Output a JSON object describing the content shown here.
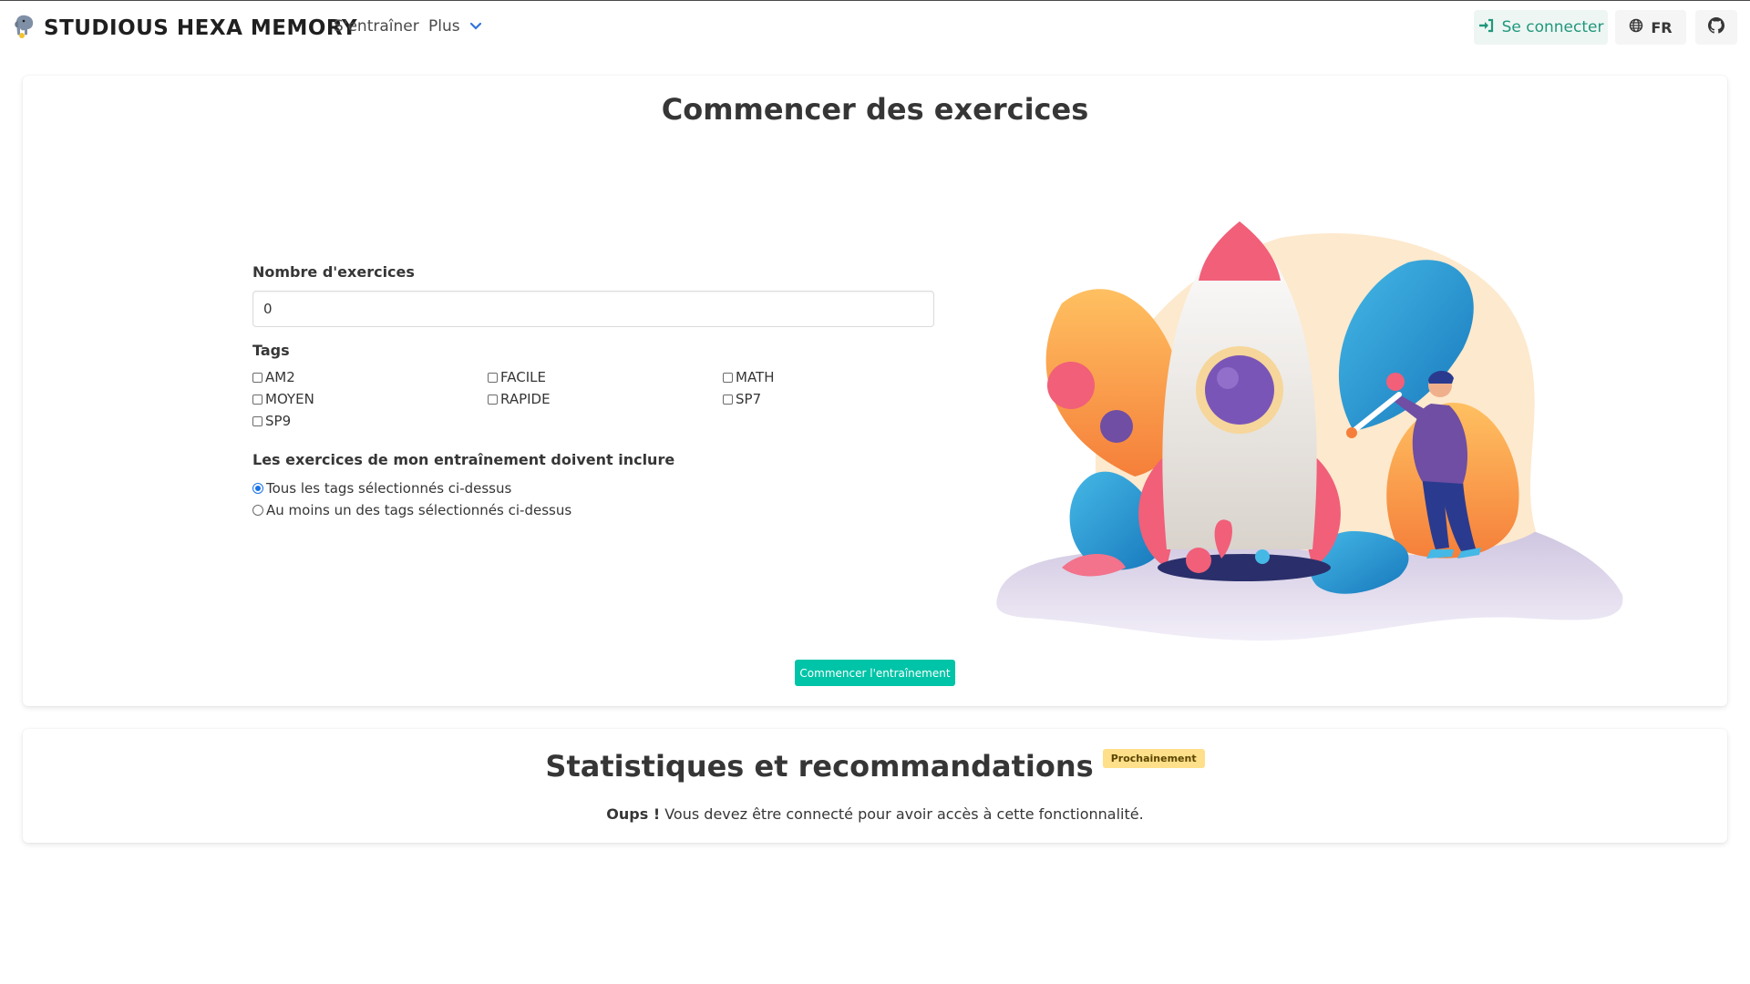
{
  "navbar": {
    "brand": "STUDIOUS HEXA MEMORY",
    "links": {
      "train": "S'entraîner",
      "more": "Plus"
    },
    "login": "Se connecter",
    "lang": "FR",
    "icons": {
      "logo": "elephant-logo",
      "more": "chevron-down-icon",
      "login": "sign-in-icon",
      "lang": "globe-icon",
      "github": "github-icon"
    },
    "accent": "#21977c"
  },
  "start_section": {
    "title": "Commencer des exercices",
    "count_label": "Nombre d'exercices",
    "count_value": "0",
    "tags_label": "Tags",
    "tags": [
      {
        "label": "AM2",
        "checked": false
      },
      {
        "label": "FACILE",
        "checked": false
      },
      {
        "label": "MATH",
        "checked": false
      },
      {
        "label": "MOYEN",
        "checked": false
      },
      {
        "label": "RAPIDE",
        "checked": false
      },
      {
        "label": "SP7",
        "checked": false
      },
      {
        "label": "SP9",
        "checked": false
      }
    ],
    "include_label": "Les exercices de mon entraînement doivent inclure",
    "include_options": [
      {
        "label": "Tous les tags sélectionnés ci-dessus",
        "checked": true
      },
      {
        "label": "Au moins un des tags sélectionnés ci-dessus",
        "checked": false
      }
    ],
    "start_button": "Commencer l'entraînement",
    "button_color": "#00c4a7"
  },
  "stats_section": {
    "title": "Statistiques et recommandations",
    "badge": "Prochainement",
    "message_bold": "Oups !",
    "message": " Vous devez être connecté pour avoir accès à cette fonctionnalité."
  }
}
